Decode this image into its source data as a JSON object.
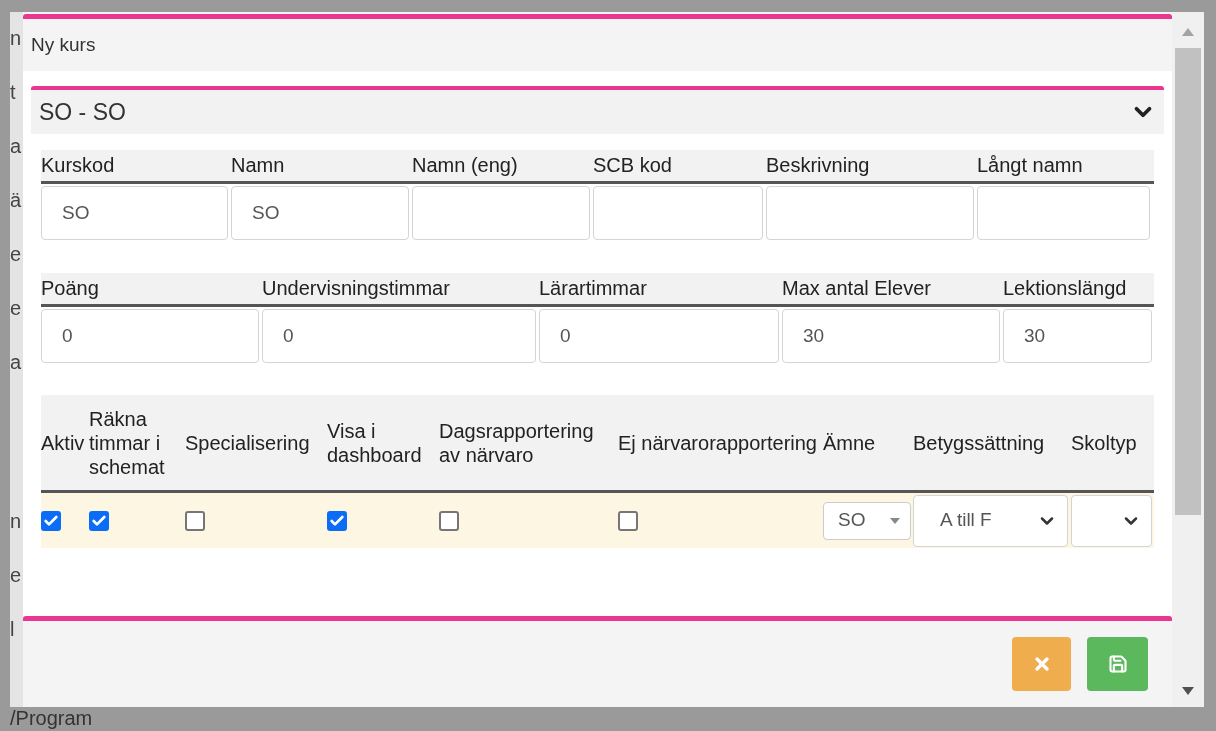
{
  "background_texts_upper": [
    "n",
    "t",
    "a",
    "ä",
    "e",
    "e",
    "a"
  ],
  "background_texts_lower": [
    "n",
    "e",
    "l"
  ],
  "background_bottom": "/Program",
  "modal": {
    "title": "Ny kurs",
    "panel": {
      "title": "SO - SO",
      "expanded": true,
      "fields_1": [
        {
          "label": "Kurskod",
          "value": "SO"
        },
        {
          "label": "Namn",
          "value": "SO"
        },
        {
          "label": "Namn (eng)"
        },
        {
          "label": "SCB kod"
        },
        {
          "label": "Beskrivning"
        },
        {
          "label": "Långt namn"
        }
      ],
      "fields_2": [
        {
          "label": "Poäng",
          "value": "0"
        },
        {
          "label": "Undervisningstimmar",
          "value": "0"
        },
        {
          "label": "Lärartimmar",
          "value": "0"
        },
        {
          "label": "Max antal Elever",
          "value": "30"
        },
        {
          "label": "Lektionslängd",
          "value": "30"
        }
      ],
      "options": [
        {
          "label": "Aktiv",
          "kind": "checkbox",
          "checked": true
        },
        {
          "label": "Räkna timmar i schemat",
          "kind": "checkbox",
          "checked": true
        },
        {
          "label": "Specialisering",
          "kind": "checkbox",
          "checked": false
        },
        {
          "label": "Visa i dashboard",
          "kind": "checkbox",
          "checked": true
        },
        {
          "label": "Dagsrapportering av närvaro",
          "kind": "checkbox",
          "checked": false
        },
        {
          "label": "Ej närvarorapportering",
          "kind": "checkbox",
          "checked": false
        },
        {
          "label": "Ämne",
          "kind": "select",
          "value": "SO"
        },
        {
          "label": "Betygssättning",
          "kind": "dropdown",
          "value": "A till F"
        },
        {
          "label": "Skoltyp",
          "kind": "dropdown"
        }
      ]
    },
    "buttons": [
      {
        "kind": "cancel"
      },
      {
        "kind": "save"
      }
    ]
  }
}
